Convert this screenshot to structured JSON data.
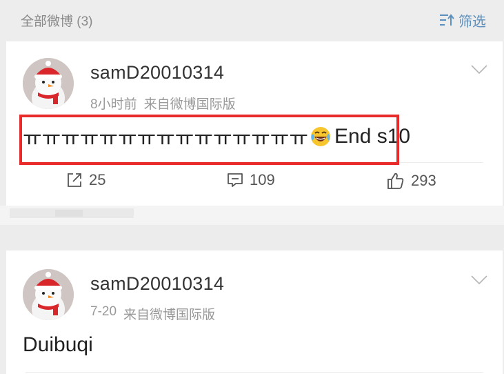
{
  "header": {
    "title": "全部微博 (3)",
    "filter_label": "筛选"
  },
  "posts": [
    {
      "username": "samD20010314",
      "time": "8小时前",
      "source": "来自微博国际版",
      "text_before": "ㅠㅠㅠㅠㅠㅠㅠㅠㅠㅠㅠㅠㅠㅠㅠ",
      "emoji": "laughing-crying-emoji",
      "text_after": " End s10",
      "reposts": "25",
      "comments": "109",
      "likes": "293"
    },
    {
      "username": "samD20010314",
      "time": "7-20",
      "source": "来自微博国际版",
      "text": "Duibuqi"
    }
  ],
  "colors": {
    "accent": "#5b8fbd",
    "highlight": "#e82a2a",
    "background": "#ededed"
  }
}
